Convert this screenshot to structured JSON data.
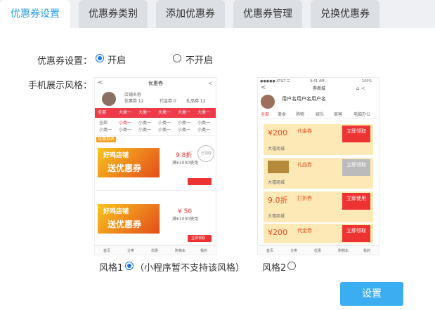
{
  "tabs": [
    "优惠券设置",
    "优惠券类别",
    "添加优惠券",
    "优惠券管理",
    "兑换优惠券"
  ],
  "form": {
    "setting_label": "优惠券设置：",
    "on_label": "开启",
    "off_label": "不开启",
    "style_label": "手机展示风格：",
    "style1_label": "风格1",
    "style1_note": "（小程序暂不支持该风格）",
    "style2_label": "风格2",
    "submit_label": "设置"
  },
  "phone1": {
    "title": "优惠券",
    "shop_name": "店铺名称",
    "stat1": "优惠券 12",
    "stat2": "代金券 0",
    "stat3": "礼品券 12",
    "cats": [
      "全部",
      "大类一",
      "大类一",
      "大类一",
      "大类一",
      "大类一"
    ],
    "sub_a": [
      "全部",
      "小类一",
      "小类一",
      "小类一",
      "小类一",
      "小类一"
    ],
    "sub_b": [
      "小类一",
      "小类一",
      "小类一",
      "小类一",
      "小类一",
      "小类一"
    ],
    "item1_tag": "优惠券名",
    "item1_discount": "9.8折",
    "item1_cond": "满¥1000使用",
    "item1_btn": "已领取",
    "item2_discount": "¥ 50",
    "item2_cond": "满¥1000使用",
    "item2_btn": "立即领取",
    "banner_top": "好鸡店铺",
    "banner_bottom": "送优惠券",
    "nav": [
      "首页",
      "分类",
      "优惠",
      "购物车",
      "我的"
    ]
  },
  "phone2": {
    "status_left": "●●●●● AT&T ☰",
    "status_time": "9:41 AM",
    "status_right": "100%",
    "title": "券商城",
    "shop": "用户名用户名用户名",
    "cats": [
      "全部",
      "美食",
      "购物",
      "娱乐",
      "美客",
      "电脑办公"
    ],
    "rows": [
      {
        "amount": "¥200",
        "kind": "代金券",
        "btn": "立即领取"
      },
      {
        "amount": "",
        "kind": "礼品券",
        "btn": "立即领取"
      },
      {
        "amount": "9.0折",
        "kind": "打折券",
        "btn": "立即使用"
      },
      {
        "amount": "¥200",
        "kind": "代金券",
        "btn": "立即领取"
      }
    ],
    "shop_row": "大禧商城",
    "nav": [
      "首页",
      "分类",
      "优惠",
      "购物车",
      "我的"
    ]
  }
}
